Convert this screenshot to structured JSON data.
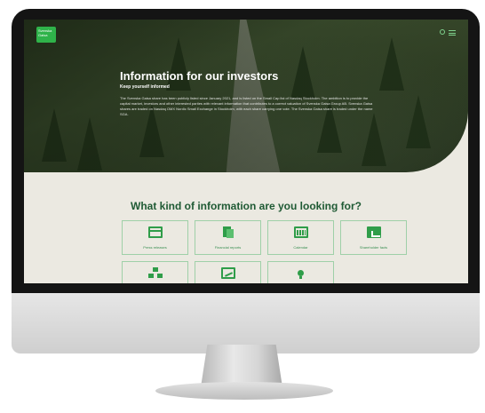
{
  "header": {
    "logo_text": "Svenska Gaisa"
  },
  "hero": {
    "title": "Information for our investors",
    "subtitle": "Keep yourself informed",
    "body": "The Svenska Gaisa share has been publicly listed since January 2021, and is listed on the Small Cap list of Nasdaq Stockholm. The ambition is to provide the capital market, investors and other interested parties with relevant information that contributes to a correct valuation of Svenska Gaisa Group AB. Svenska Gaisa shares are traded on Nasdaq OMX Nordic Small Exchange in Stockholm, with each share carrying one vote. The Svenska Gaisa share is traded under the name SGA."
  },
  "section": {
    "title": "What kind of information are you looking for?"
  },
  "tiles": [
    {
      "label": "Press releases",
      "icon": "press-releases-icon"
    },
    {
      "label": "Financial reports",
      "icon": "financial-reports-icon"
    },
    {
      "label": "Calendar",
      "icon": "calendar-icon"
    },
    {
      "label": "Shareholder facts",
      "icon": "shareholder-chart-icon"
    },
    {
      "label": "",
      "icon": "organization-icon"
    },
    {
      "label": "",
      "icon": "presentation-chart-icon"
    },
    {
      "label": "",
      "icon": "idea-icon"
    }
  ],
  "colors": {
    "accent": "#2f9d49",
    "title_green": "#1f5a34",
    "background": "#ebe9e1"
  }
}
